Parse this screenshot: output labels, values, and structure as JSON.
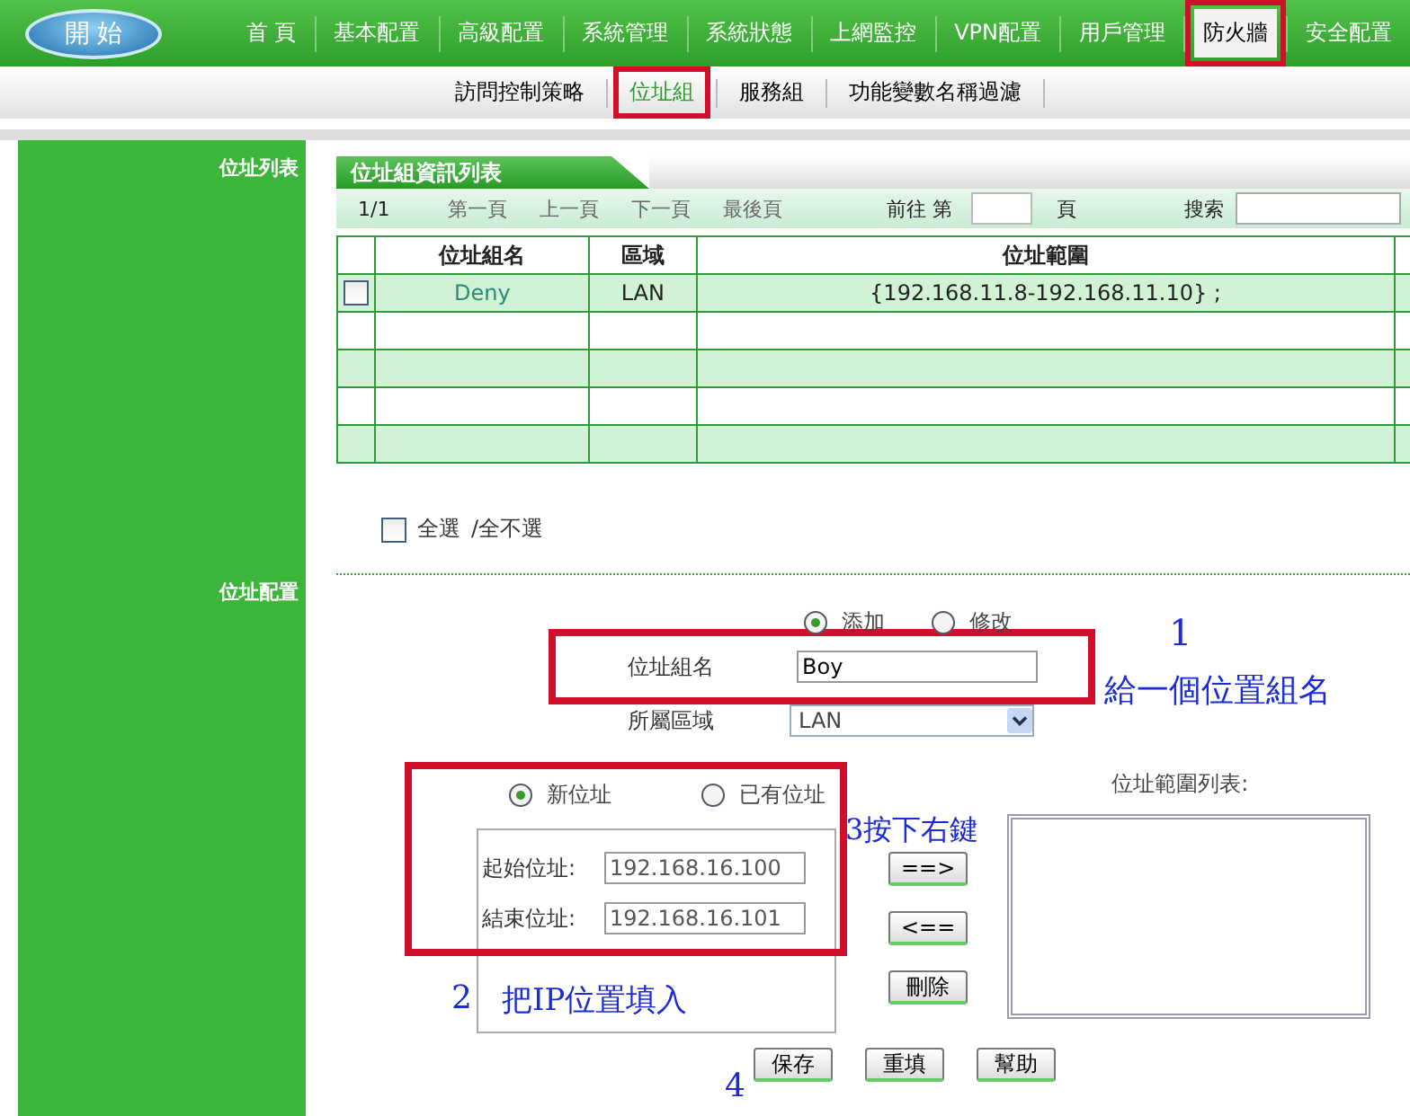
{
  "logo": {
    "label": "開 始"
  },
  "nav": [
    {
      "label": "首 頁",
      "selected": false,
      "highlighted": false
    },
    {
      "label": "基本配置",
      "selected": false,
      "highlighted": false
    },
    {
      "label": "高級配置",
      "selected": false,
      "highlighted": false
    },
    {
      "label": "系統管理",
      "selected": false,
      "highlighted": false
    },
    {
      "label": "系統狀態",
      "selected": false,
      "highlighted": false
    },
    {
      "label": "上網監控",
      "selected": false,
      "highlighted": false
    },
    {
      "label": "VPN配置",
      "selected": false,
      "highlighted": false
    },
    {
      "label": "用戶管理",
      "selected": false,
      "highlighted": false
    },
    {
      "label": "防火牆",
      "selected": true,
      "highlighted": true
    },
    {
      "label": "安全配置",
      "selected": false,
      "highlighted": false
    }
  ],
  "subnav": [
    {
      "label": "訪問控制策略",
      "selected": false,
      "highlighted": false
    },
    {
      "label": "位址組",
      "selected": true,
      "highlighted": true
    },
    {
      "label": "服務組",
      "selected": false,
      "highlighted": false
    },
    {
      "label": "功能變數名稱過濾",
      "selected": false,
      "highlighted": false
    }
  ],
  "sidebar": [
    "位址列表",
    "位址配置"
  ],
  "table": {
    "title": "位址組資訊列表",
    "page": "1/1",
    "pager": [
      "第一頁",
      "上一頁",
      "下一頁",
      "最後頁"
    ],
    "goto_label": "前往  第",
    "page_suffix": "頁",
    "search_label": "搜索",
    "columns": [
      "位址組名",
      "區域",
      "位址範圍"
    ],
    "rows": [
      {
        "checked": false,
        "cells": [
          "Deny",
          "LAN",
          "{192.168.11.8-192.168.11.10} ;"
        ]
      }
    ]
  },
  "select_all": {
    "checked": false,
    "label": "全選",
    "label2": "/全不選"
  },
  "form": {
    "modes": [
      {
        "label": "添加",
        "selected": true
      },
      {
        "label": "修改",
        "selected": false
      }
    ],
    "name_label": "位址組名",
    "name_value": "Boy",
    "name_highlighted": true,
    "zone_label": "所屬區域",
    "zone_value": "LAN",
    "sources": [
      {
        "label": "新位址",
        "selected": true
      },
      {
        "label": "已有位址",
        "selected": false
      }
    ],
    "source_highlighted": true,
    "start_label": "起始位址:",
    "start_value": "192.168.16.100",
    "end_label": "結束位址:",
    "end_value": "192.168.16.101",
    "move_buttons": [
      "==>",
      "<==",
      "刪除"
    ],
    "list_label": "位址範圍列表:",
    "actions": [
      "保存",
      "重填",
      "幫助"
    ]
  },
  "annotations": {
    "step1_number": "1",
    "step1_text": "給一個位置組名",
    "step2_number": "2",
    "step2_text": "把IP位置填入",
    "step3_text": "3按下右鍵",
    "step4_number": "4"
  }
}
